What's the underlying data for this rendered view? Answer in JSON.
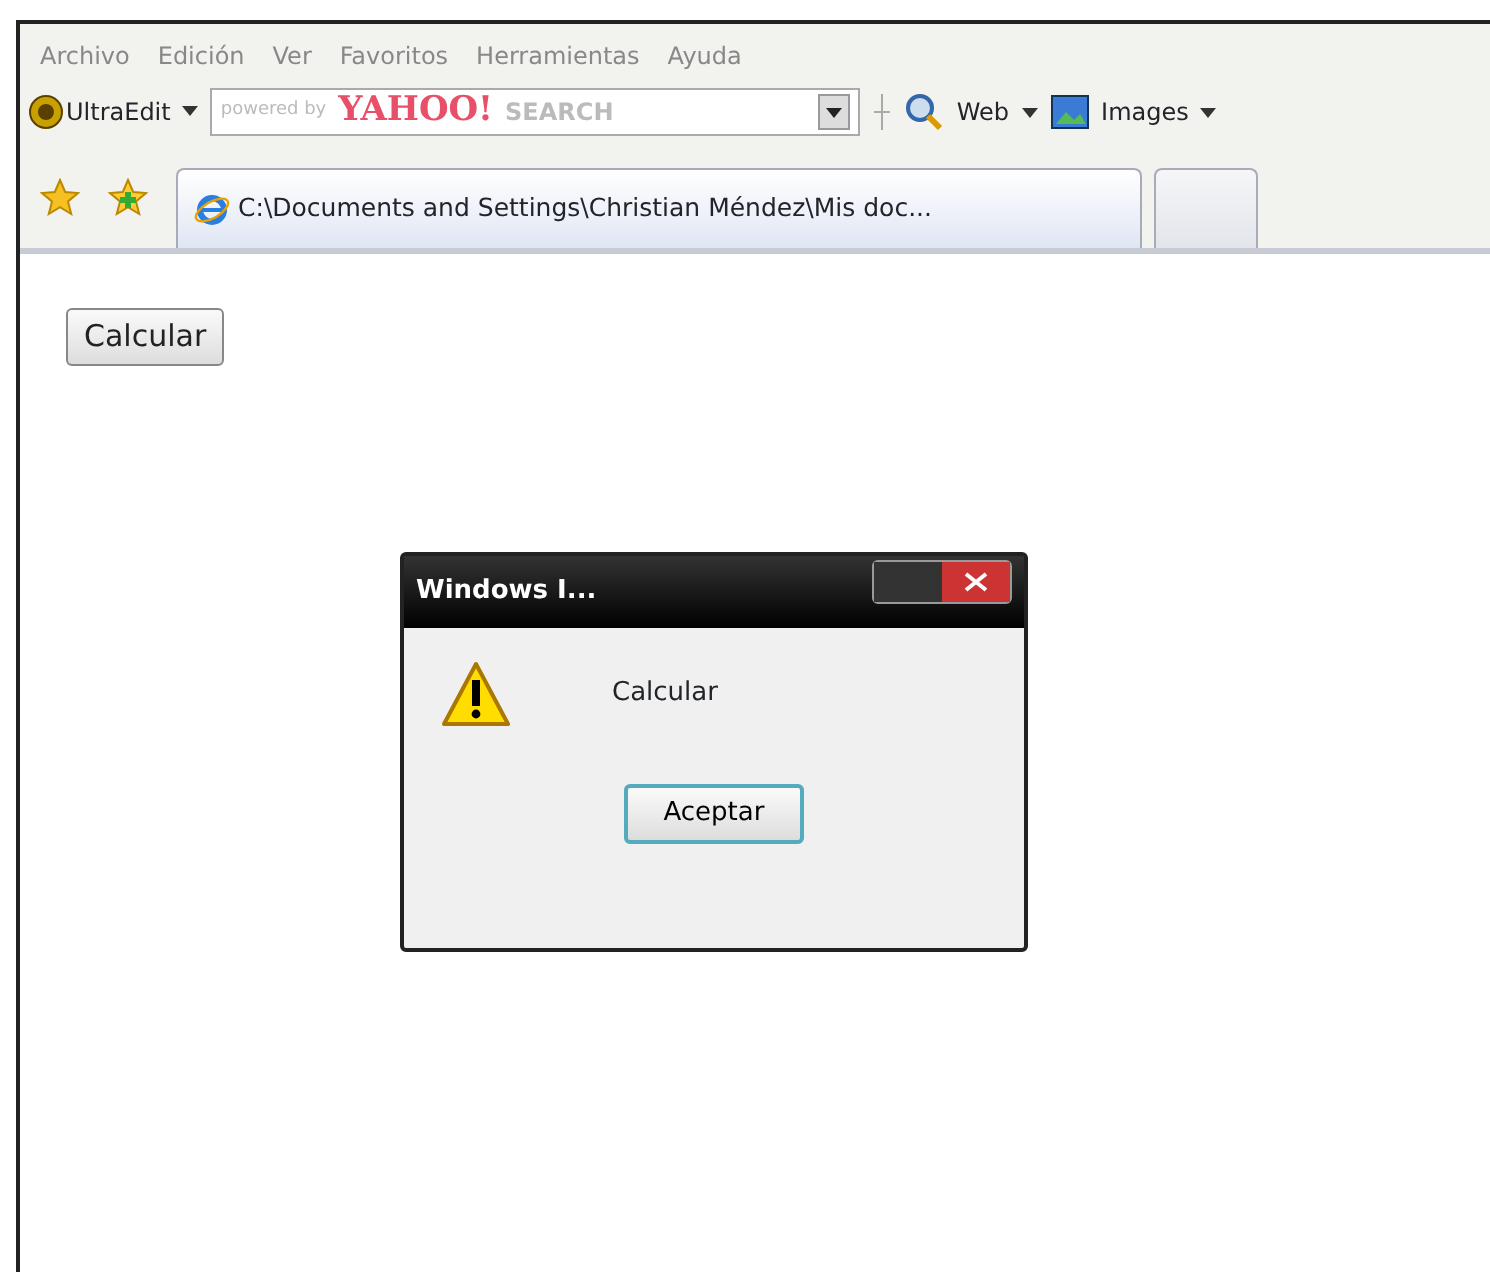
{
  "menu": [
    "Archivo",
    "Edición",
    "Ver",
    "Favoritos",
    "Herramientas",
    "Ayuda"
  ],
  "toolbar": {
    "ultraedit": "UltraEdit",
    "search_powered": "powered by",
    "search_brand": "YAHOO!",
    "search_word": "SEARCH",
    "web": "Web",
    "images": "Images"
  },
  "tabs": [
    {
      "label": "C:\\Documents and Settings\\Christian Méndez\\Mis doc...",
      "selected": true
    },
    {
      "selected": false
    }
  ],
  "page": {
    "button": "Calcular"
  },
  "dialog": {
    "title": "Windows I...",
    "message": "Calcular",
    "ok": "Aceptar"
  }
}
